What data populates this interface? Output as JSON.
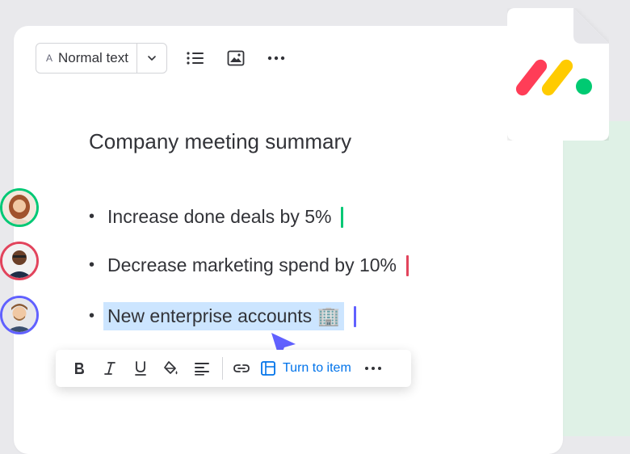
{
  "toolbar": {
    "style_prefix": "A",
    "style_value": "Normal text",
    "icons": [
      "chevron-down-icon",
      "bullet-list-icon",
      "image-icon",
      "more-icon"
    ]
  },
  "document": {
    "title": "Company meeting summary",
    "bullets": [
      {
        "text": "Increase done deals by 5%",
        "caret_color": "#00c875"
      },
      {
        "text": "Decrease marketing spend by 10%",
        "caret_color": "#e2445c"
      },
      {
        "text": "New enterprise accounts 🏢",
        "caret_color": "#6161ff"
      }
    ]
  },
  "format_bar": {
    "turn_to_item_label": "Turn to item",
    "icons": [
      "bold-icon",
      "italic-icon",
      "underline-icon",
      "paint-bucket-icon",
      "align-left-icon",
      "link-icon",
      "item-icon",
      "more-icon"
    ]
  },
  "colors": {
    "highlight": "#cce5ff",
    "accent": "#0073ea",
    "cursor": "#6161ff"
  },
  "avatars": [
    "avatar-green-ring",
    "avatar-red-ring",
    "avatar-purple-ring"
  ]
}
